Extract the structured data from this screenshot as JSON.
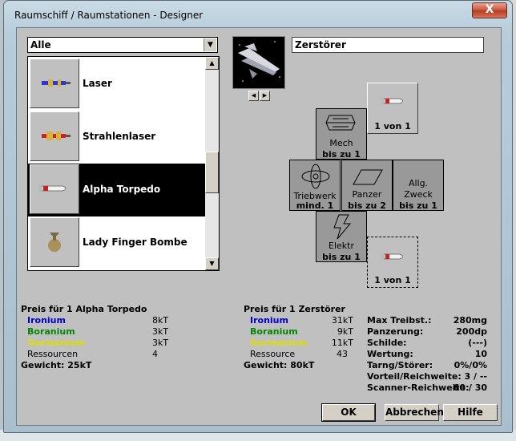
{
  "window": {
    "title": "Raumschiff / Raumstationen - Designer",
    "close_label": "X"
  },
  "filter": {
    "value": "Alle"
  },
  "component_list": {
    "items": [
      {
        "label": "Laser",
        "icon": "laser-icon",
        "selected": false
      },
      {
        "label": "Strahlenlaser",
        "icon": "beam-laser-icon",
        "selected": false
      },
      {
        "label": "Alpha Torpedo",
        "icon": "torpedo-icon",
        "selected": true
      },
      {
        "label": "Lady Finger Bombe",
        "icon": "bomb-icon",
        "selected": false
      }
    ]
  },
  "design": {
    "name": "Zerstörer"
  },
  "slots": {
    "weapon_top": {
      "count": "1 von 1"
    },
    "mech": {
      "line1": "Mech",
      "line2": "bis zu 1"
    },
    "engine": {
      "line1": "Triebwerk",
      "line2": "mind. 1"
    },
    "armor": {
      "line1": "Panzer",
      "line2": "bis zu 2"
    },
    "general": {
      "line1": "Allg.",
      "line1b": "Zweck",
      "line2": "bis zu 1"
    },
    "elec": {
      "line1": "Elektr",
      "line2": "bis zu 1"
    },
    "weapon_bottom": {
      "count": "1 von 1"
    }
  },
  "component_cost": {
    "title": "Preis für 1 Alpha Torpedo",
    "rows": [
      {
        "label": "Ironium",
        "value": "8kT"
      },
      {
        "label": "Boranium",
        "value": "3kT"
      },
      {
        "label": "Germanium",
        "value": "3kT"
      },
      {
        "label": "Ressourcen",
        "value": "4"
      }
    ],
    "weight": "Gewicht: 25kT"
  },
  "ship_cost": {
    "title": "Preis für 1 Zerstörer",
    "rows": [
      {
        "label": "Ironium",
        "value": "31kT"
      },
      {
        "label": "Boranium",
        "value": "9kT"
      },
      {
        "label": "Germanium",
        "value": "11kT"
      },
      {
        "label": "Ressource",
        "value": "43"
      }
    ],
    "weight": "Gewicht: 80kT"
  },
  "ship_stats": [
    {
      "label": "Max Treibst.:",
      "value": "280mg"
    },
    {
      "label": "Panzerung:",
      "value": "200dp"
    },
    {
      "label": "Schilde:",
      "value": "(---)"
    },
    {
      "label": "Wertung:",
      "value": "10"
    },
    {
      "label": "Tarng/Störer:",
      "value": "0%/0%"
    },
    {
      "label": "Vorteil/Reichweite:",
      "value": "3 / --"
    },
    {
      "label": "Scanner-Reichweite:",
      "value": "60 / 30"
    }
  ],
  "buttons": {
    "ok": "OK",
    "cancel": "Abbrechen",
    "help": "Hilfe"
  },
  "colors": {
    "ironium": "#0000cc",
    "boranium": "#008800",
    "germanium": "#dddd00",
    "selection": "#000000"
  }
}
